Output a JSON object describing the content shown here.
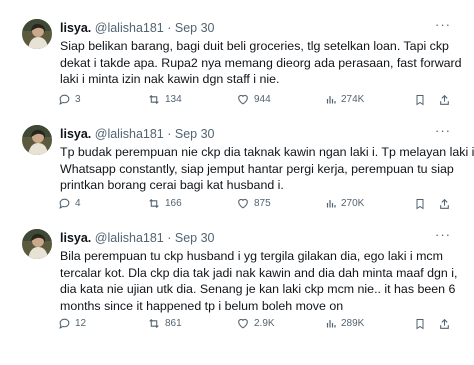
{
  "tweets": [
    {
      "name": "lisya.",
      "handle": "@lalisha181",
      "sep": "·",
      "date": "Sep 30",
      "more": "···",
      "text": [
        "Siap belikan barang, bagi duit beli groceries, tlg setelkan loan. Tapi ckp",
        "dekat i takde apa. Rupa2 nya memang dieorg ada perasaan, fast forward",
        "laki i minta izin nak kawin dgn staff i nie."
      ],
      "replies": "3",
      "reposts": "134",
      "likes": "944",
      "views": "274K"
    },
    {
      "name": "lisya.",
      "handle": "@lalisha181",
      "sep": "·",
      "date": "Sep 30",
      "more": "···",
      "text": [
        "Tp budak perempuan nie ckp dia taknak kawin ngan laki i. Tp melayan laki i.",
        "Whatsapp constantly, siap jemput hantar pergi kerja, perempuan tu siap",
        "printkan borang  cerai bagi kat husband i."
      ],
      "replies": "4",
      "reposts": "166",
      "likes": "875",
      "views": "270K"
    },
    {
      "name": "lisya.",
      "handle": "@lalisha181",
      "sep": "·",
      "date": "Sep 30",
      "more": "···",
      "text": [
        "Bila perempuan tu ckp husband i yg tergila gilakan dia, ego laki i mcm",
        "tercalar kot. Dla ckp dia tak jadi nak kawin and dia dah minta maaf dgn i,",
        "dia kata nie ujian utk dia. Senang je kan laki ckp mcm nie.. it has been 6",
        "months since it happened tp i belum boleh move on"
      ],
      "replies": "12",
      "reposts": "861",
      "likes": "2.9K",
      "views": "289K"
    }
  ],
  "icons": {
    "reply": "reply-icon",
    "repost": "repost-icon",
    "like": "heart-icon",
    "views": "analytics-icon",
    "bookmark": "bookmark-icon",
    "share": "share-icon"
  },
  "colors": {
    "text": "#0f1419",
    "muted": "#536471",
    "background": "#ffffff"
  }
}
